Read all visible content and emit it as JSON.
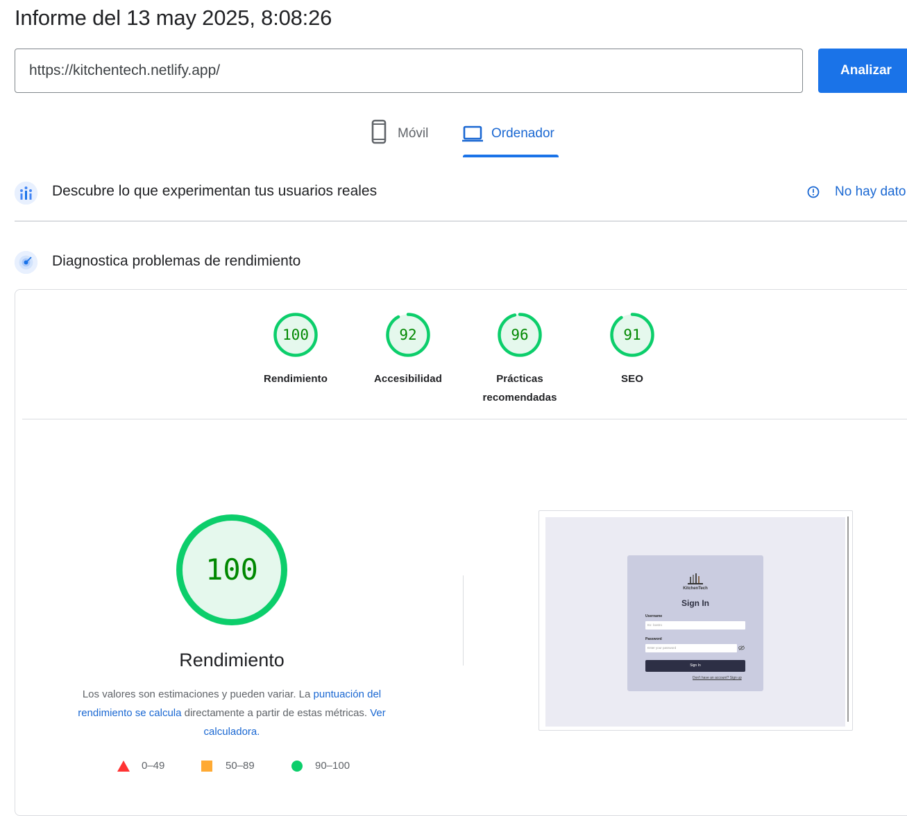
{
  "header": {
    "title": "Informe del 13 may 2025, 8:08:26",
    "url_value": "https://kitchentech.netlify.app/",
    "analyze_label": "Analizar"
  },
  "tabs": {
    "mobile_label": "Móvil",
    "desktop_label": "Ordenador",
    "active": "Ordenador"
  },
  "field_data": {
    "title": "Descubre lo que experimentan tus usuarios reales",
    "no_data_label": "No hay dato"
  },
  "diagnostics": {
    "title": "Diagnostica problemas de rendimiento"
  },
  "scores": [
    {
      "value": "100",
      "label_line1": "Rendimiento",
      "label_line2": ""
    },
    {
      "value": "92",
      "label_line1": "Accesibilidad",
      "label_line2": ""
    },
    {
      "value": "96",
      "label_line1": "Prácticas",
      "label_line2": "recomendadas"
    },
    {
      "value": "91",
      "label_line1": "SEO",
      "label_line2": ""
    }
  ],
  "performance": {
    "score": "100",
    "title": "Rendimiento",
    "explain_text_1": "Los valores son estimaciones y pueden variar. La ",
    "explain_link_1": "puntuación del rendimiento se calcula",
    "explain_text_2": " directamente a partir de estas métricas. ",
    "explain_link_2": "Ver calculadora."
  },
  "legend": [
    {
      "range": "0–49",
      "color": "#ff3333"
    },
    {
      "range": "50–89",
      "color": "#ffaa33"
    },
    {
      "range": "90–100",
      "color": "#0cce6b"
    }
  ],
  "screenshot": {
    "brand": "KitchenTech",
    "title": "Sign In",
    "username_label": "Username",
    "username_placeholder": "Ex: lcastro",
    "password_label": "Password",
    "password_placeholder": "Enter your password",
    "button_label": "Sign In",
    "signup_text": "Don't have an account? Sign up"
  },
  "colors": {
    "pass": "#0cce6b",
    "pass_text": "#008800",
    "pass_fill": "#e5f8ed",
    "link": "#1967d2",
    "primary_button": "#1a73e8"
  }
}
